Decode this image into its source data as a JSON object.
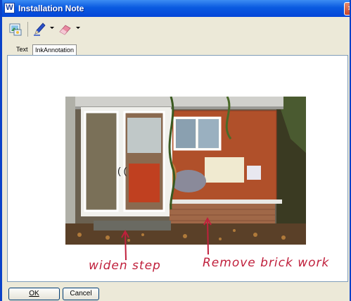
{
  "window": {
    "title": "Installation Note",
    "app_icon_letter": "W",
    "close_glyph": "×"
  },
  "toolbar": {
    "tools": [
      {
        "name": "image-tool",
        "icon": "image-icon"
      },
      {
        "name": "pen-tool",
        "icon": "pen-icon",
        "color": "#2a50c8"
      },
      {
        "name": "eraser-tool",
        "icon": "eraser-icon",
        "color": "#e88aa0"
      }
    ]
  },
  "tabs": [
    {
      "label": "Text",
      "active": false
    },
    {
      "label": "InkAnnotation",
      "active": true
    }
  ],
  "annotations": {
    "left": "widen step",
    "right": "Remove brick work",
    "ink_color": "#c0203c"
  },
  "buttons": {
    "ok": "OK",
    "cancel": "Cancel"
  }
}
